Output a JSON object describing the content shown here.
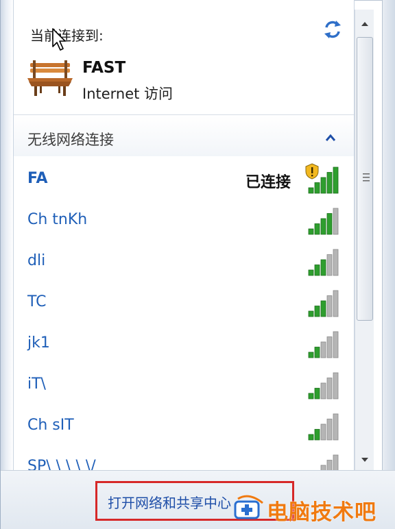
{
  "current": {
    "label": "当前连接到:",
    "network_name": "FAST",
    "access": "Internet 访问"
  },
  "wireless": {
    "section_title": "无线网络连接",
    "networks": [
      {
        "name": "FA",
        "status": "已连接",
        "signal_bars": 5
      },
      {
        "name": "Ch            tnKh",
        "signal_bars": 4
      },
      {
        "name": "dli",
        "signal_bars": 3
      },
      {
        "name": "TC",
        "signal_bars": 3
      },
      {
        "name": "jk1",
        "signal_bars": 2
      },
      {
        "name": "iT\\",
        "signal_bars": 2
      },
      {
        "name": "Ch            sIT",
        "signal_bars": 2
      },
      {
        "name": "SP\\ \\ \\ \\ \\/",
        "signal_bars": 2
      }
    ]
  },
  "footer": {
    "link": "打开网络和共享中心"
  },
  "watermark": {
    "text": "电脑技术吧"
  },
  "colors": {
    "link_blue": "#1f5fb8",
    "signal_green": "#2e9e2e",
    "signal_gray": "#b5b5b5",
    "highlight_red": "#d62828",
    "watermark_orange": "#f07a10"
  }
}
